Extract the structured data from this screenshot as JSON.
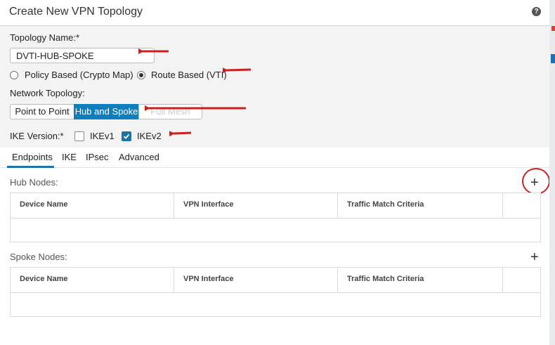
{
  "dialog": {
    "title": "Create New VPN Topology",
    "help_icon": "question-circle-icon"
  },
  "form": {
    "topology_name_label": "Topology Name:*",
    "topology_name_value": "DVTI-HUB-SPOKE",
    "radio_policy_label": "Policy Based (Crypto Map)",
    "radio_route_label": "Route Based (VTI)",
    "selected_type": "Route Based (VTI)",
    "network_topology_label": "Network Topology:",
    "topology_options": [
      "Point to Point",
      "Hub and Spoke",
      "Full Mesh"
    ],
    "selected_topology": "Hub and Spoke",
    "ike_version_label": "IKE Version:*",
    "ikev1_label": "IKEv1",
    "ikev2_label": "IKEv2",
    "ikev1_checked": false,
    "ikev2_checked": true
  },
  "tabs": [
    "Endpoints",
    "IKE",
    "IPsec",
    "Advanced"
  ],
  "active_tab": "Endpoints",
  "hub_nodes": {
    "label": "Hub Nodes:",
    "columns": [
      "Device Name",
      "VPN Interface",
      "Traffic Match Criteria"
    ]
  },
  "spoke_nodes": {
    "label": "Spoke Nodes:",
    "columns": [
      "Device Name",
      "VPN Interface",
      "Traffic Match Criteria"
    ]
  },
  "icons": {
    "add": "plus-icon"
  },
  "colors": {
    "accent": "#0d7fbf",
    "annotation": "#cc1f1f"
  }
}
